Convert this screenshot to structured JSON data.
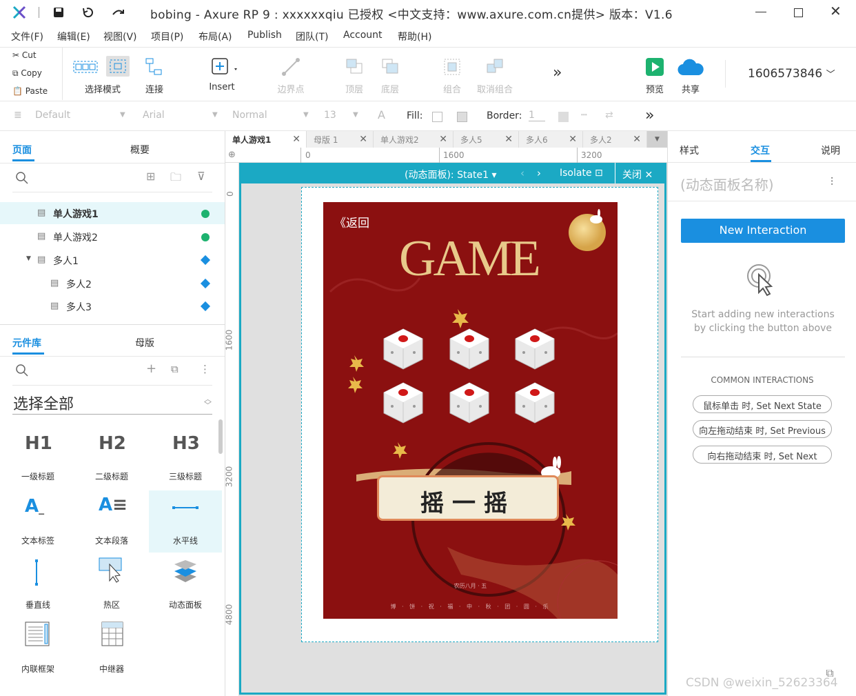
{
  "window": {
    "title": "bobing - Axure RP 9 : xxxxxxqiu 已授权 <中文支持：www.axure.com.cn提供> 版本：V1.6"
  },
  "menu": [
    "文件(F)",
    "编辑(E)",
    "视图(V)",
    "项目(P)",
    "布局(A)",
    "Publish",
    "团队(T)",
    "Account",
    "帮助(H)"
  ],
  "clipboard": {
    "cut": "Cut",
    "copy": "Copy",
    "paste": "Paste"
  },
  "toolbar": {
    "select_mode": "选择模式",
    "connect": "连接",
    "insert": "Insert",
    "boundary": "边界点",
    "top": "顶层",
    "bottom": "底层",
    "group": "组合",
    "ungroup": "取消组合",
    "preview": "预览",
    "share": "共享",
    "account": "1606573846"
  },
  "stylebar": {
    "style": "Default",
    "font": "Arial",
    "weight": "Normal",
    "size": "13",
    "fill_label": "Fill:",
    "border_label": "Border:",
    "border_value": "1"
  },
  "left": {
    "tab_pages": "页面",
    "tab_outline": "概要",
    "pages": [
      {
        "name": "单人游戏1",
        "status": "check",
        "selected": true
      },
      {
        "name": "单人游戏2",
        "status": "check"
      },
      {
        "name": "多人1",
        "status": "diamond"
      },
      {
        "name": "多人2",
        "status": "diamond"
      },
      {
        "name": "多人3",
        "status": "diamond"
      }
    ],
    "tab_library": "元件库",
    "tab_masters": "母版",
    "library_select": "选择全部",
    "widgets": [
      {
        "glyph": "H1",
        "label": "一级标题"
      },
      {
        "glyph": "H2",
        "label": "二级标题"
      },
      {
        "glyph": "H3",
        "label": "三级标题"
      },
      {
        "glyph": "A_",
        "label": "文本标签"
      },
      {
        "glyph": "A≡",
        "label": "文本段落"
      },
      {
        "glyph": "—",
        "label": "水平线"
      },
      {
        "glyph": "|",
        "label": "垂直线"
      },
      {
        "glyph": "hotspot",
        "label": "热区"
      },
      {
        "glyph": "layers",
        "label": "动态面板"
      },
      {
        "glyph": "frame",
        "label": "内联框架"
      },
      {
        "glyph": "repeater",
        "label": "中继器"
      }
    ]
  },
  "doc_tabs": [
    "单人游戏1",
    "母版 1",
    "单人游戏2",
    "多人5",
    "多人6",
    "多人2"
  ],
  "ruler": {
    "h": [
      "0",
      "1600",
      "3200"
    ],
    "v": [
      "0",
      "1600",
      "3200",
      "4800"
    ]
  },
  "panel_bar": {
    "state": "(动态面板): State1",
    "isolate": "Isolate",
    "close": "关闭"
  },
  "game": {
    "back": "《返回",
    "title": "GAME",
    "button": "摇一摇",
    "date": "农历八月 · 五",
    "footer": "博 · 饼 · 祝 · 福 · 中 · 秋 · 团 · 圆 · 乐"
  },
  "right": {
    "tabs": [
      "样式",
      "交互",
      "说明"
    ],
    "panel_name_placeholder": "(动态面板名称)",
    "new_interaction": "New Interaction",
    "hint": "Start adding new interactions by clicking the button above",
    "common_title": "COMMON INTERACTIONS",
    "common": [
      "鼠标单击 时, Set Next State",
      "向左拖动结束 时, Set Previous",
      "向右拖动结束 时, Set Next"
    ]
  },
  "watermark": "CSDN @weixin_52623364",
  "colors": {
    "accent": "#1ba9c4",
    "blue": "#1a8fe0",
    "game_bg": "#8b1010",
    "gold": "#e8c98a"
  }
}
